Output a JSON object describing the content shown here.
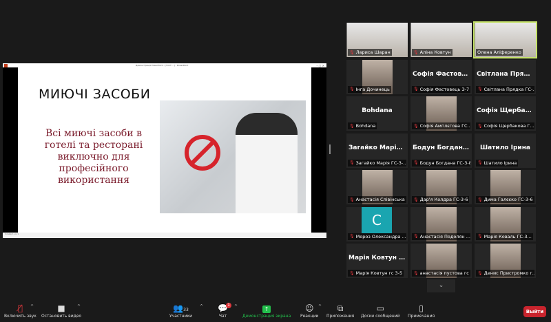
{
  "shared_window": {
    "title": "Демонстрація PowerPoint - [ГОСТ... ] - PowerPoint",
    "status": "Слайд 1 из 1",
    "slide": {
      "title": "МИЮЧІ ЗАСОБИ",
      "body": "Всі миючі засоби в готелі та ресторані виключно для професійного використання"
    }
  },
  "participants": [
    {
      "big": "",
      "label": "Лариса Шаран",
      "video": true
    },
    {
      "big": "",
      "label": "Аліна Ковтун",
      "video": true
    },
    {
      "big": "",
      "label": "Олена Аліференко",
      "video": true,
      "active": true
    },
    {
      "big": "",
      "label": "Інга Дочинець",
      "photo": true
    },
    {
      "big": "Софія Фастове...",
      "label": "Софія Фастовець З-7"
    },
    {
      "big": "Світлана Прядк...",
      "label": "Світлана Прядка ГС-..."
    },
    {
      "big": "Bohdana",
      "label": "Bohdana"
    },
    {
      "big": "",
      "label": "Софія Амплєгова ГС...",
      "photo": true
    },
    {
      "big": "Софія Щербако...",
      "label": "Софія Щербакова Г..."
    },
    {
      "big": "Загайко Марія...",
      "label": "Загайко Марія ГС-3-..."
    },
    {
      "big": "Бодун Богдана...",
      "label": "Бодун Богдана ГС-3-8"
    },
    {
      "big": "Шатило Ірина",
      "label": "Шатило Ірина"
    },
    {
      "big": "",
      "label": "Анастасія Слівінська ...",
      "photo": true
    },
    {
      "big": "",
      "label": "Дар'я Колдра ГС-3-6",
      "photo": true
    },
    {
      "big": "",
      "label": "Дима Галєєко ГС-3-6",
      "photo": true
    },
    {
      "big": "",
      "label": "Мороз Олександра ...",
      "avatar": "C"
    },
    {
      "big": "",
      "label": "Анастасія Подолян ...",
      "photo": true
    },
    {
      "big": "",
      "label": "Марія Коваль ГС-3...",
      "photo": true
    },
    {
      "big": "Марія Ковтун г...",
      "label": "Марія Ковтун гс 3-5"
    },
    {
      "big": "",
      "label": "анастасія пустова гс ...",
      "photo": true
    },
    {
      "big": "",
      "label": "Денис Пристромко г...",
      "photo": true
    }
  ],
  "toolbar": {
    "unmute": "Включить звук",
    "stop_video": "Остановить видео",
    "participants": "Участники",
    "participants_count": "33",
    "chat": "Чат",
    "chat_badge": "1",
    "share": "Демонстрация экрана",
    "reactions": "Реакции",
    "apps": "Приложения",
    "whiteboards": "Доски сообщений",
    "notes": "Примечания",
    "leave": "Выйти"
  },
  "colors": {
    "share": "#23c04c",
    "leave": "#c9242d",
    "active_speaker": "#c5e26a"
  }
}
